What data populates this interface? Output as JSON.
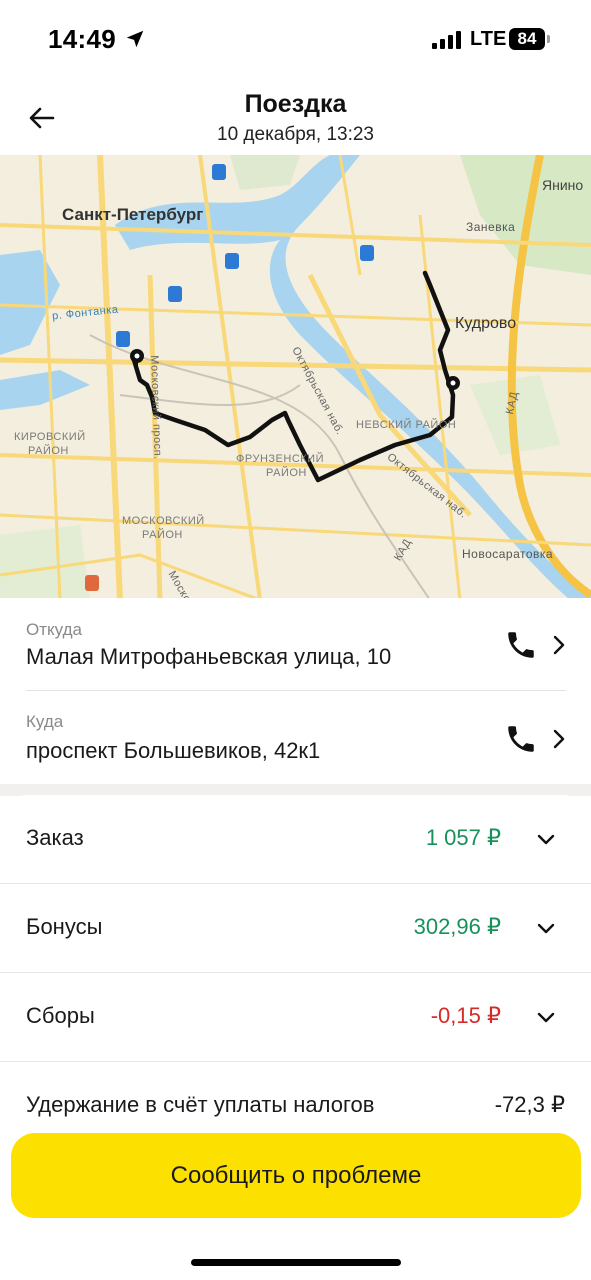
{
  "status_bar": {
    "time": "14:49",
    "network": "LTE",
    "battery": "84"
  },
  "header": {
    "title": "Поездка",
    "subtitle": "10 декабря, 13:23",
    "back_icon": "arrow-left-icon"
  },
  "map": {
    "labels": {
      "city": "Санкт-Петербург",
      "yanino": "Янино",
      "zanevka": "Заневка",
      "kudrovo": "Кудрово",
      "fontanka": "р. Фонтанка",
      "kirovsky_1": "КИРОВСКИЙ",
      "kirovsky_2": "РАЙОН",
      "frunzensky_1": "ФРУНЗЕНСКИЙ",
      "frunzensky_2": "РАЙОН",
      "nevsky": "НЕВСКИЙ РАЙОН",
      "moskovsky_1": "МОСКОВСКИЙ",
      "moskovsky_2": "РАЙОН",
      "oktyabrskaya_1": "Октябрьская наб.",
      "oktyabrskaya_2": "Октябрьская наб.",
      "kad_1": "КАД",
      "kad_2": "КАД",
      "novosaratovka": "Новосаратовка",
      "moskovsky_prosp": "Московский просп.",
      "moskovsky_short": "Моско"
    },
    "colors": {
      "land": "#f3eedd",
      "water": "#a9d4ef",
      "road": "#f9d879",
      "route": "#111111",
      "park": "#d6e8c4"
    }
  },
  "route": {
    "from_caption": "Откуда",
    "from_address": "Малая Митрофаньевская улица, 10",
    "to_caption": "Куда",
    "to_address": "проспект Большевиков, 42к1",
    "phone_icon": "phone-icon",
    "chevron_icon": "chevron-right-icon"
  },
  "finance": {
    "order_label": "Заказ",
    "order_amount": "1 057 ₽",
    "bonus_label": "Бонусы",
    "bonus_amount": "302,96 ₽",
    "fees_label": "Сборы",
    "fees_amount": "-0,15 ₽",
    "tax_label": "Удержание в счёт уплаты налогов",
    "tax_amount": "-72,3 ₽",
    "colors": {
      "positive": "#17915a",
      "negative": "#d52a2a"
    }
  },
  "actions": {
    "report_button": "Сообщить о проблеме",
    "button_color": "#fce000"
  }
}
